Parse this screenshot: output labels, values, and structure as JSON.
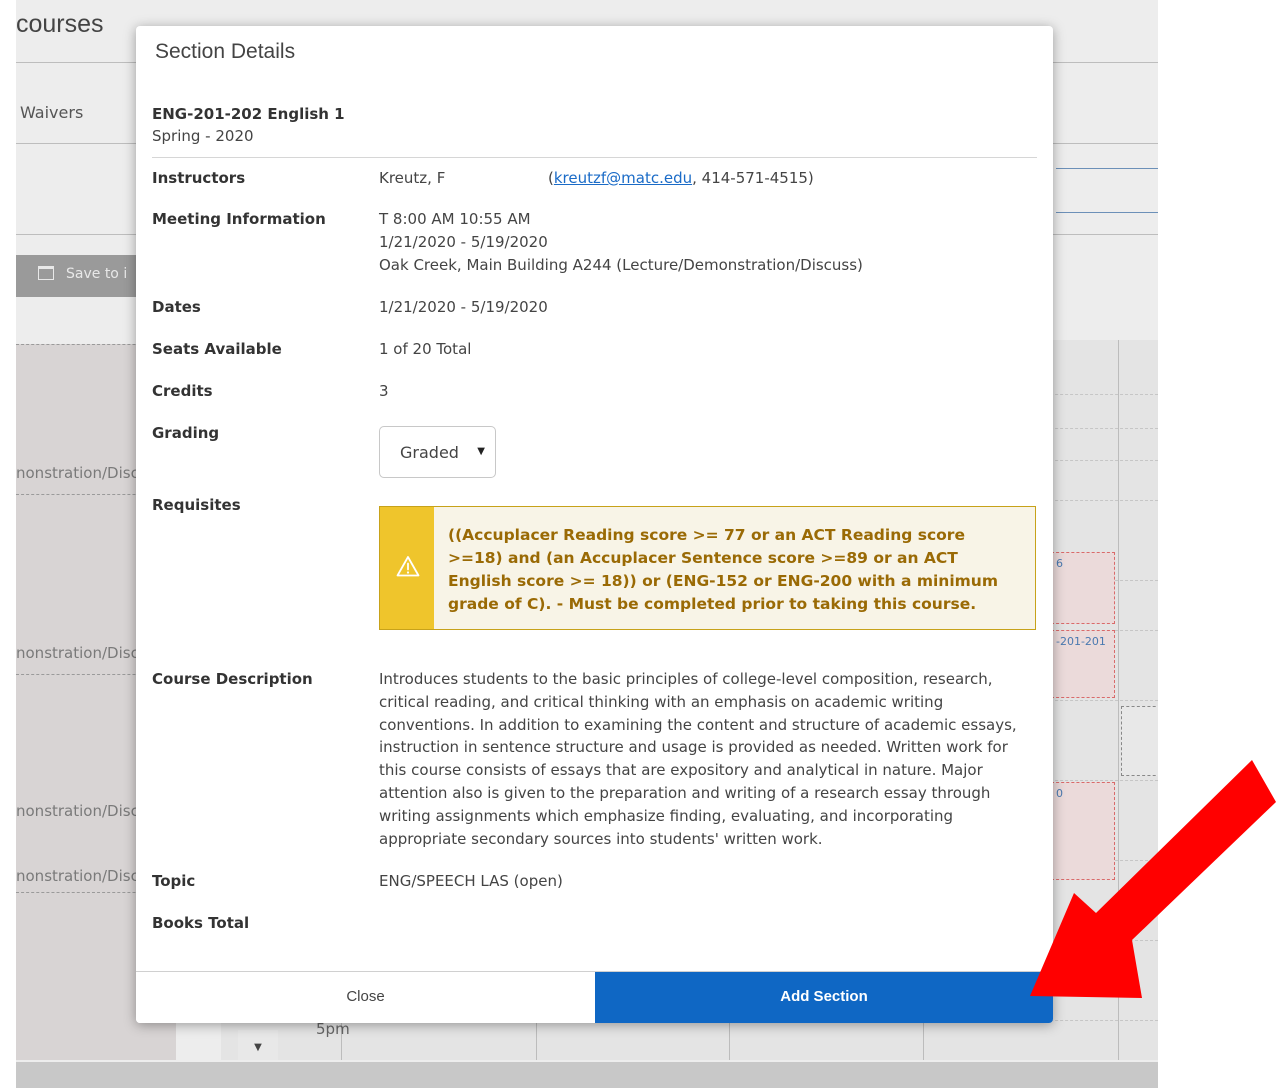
{
  "background": {
    "page_title": "courses",
    "tab_label": "Waivers",
    "save_button_label": "Save to i",
    "list_items": [
      "nonstration/Disc",
      "nonstration/Disc",
      "nonstration/Disc",
      "nonstration/Disc"
    ],
    "cal_cells": [
      "6",
      "-201-201",
      "0"
    ],
    "time_label": "5pm"
  },
  "modal": {
    "title": "Section Details",
    "course_name": "ENG-201-202 English 1",
    "course_term": "Spring - 2020",
    "instructors": {
      "label": "Instructors",
      "name": "Kreutz, F",
      "paren_open": "(",
      "email": "kreutzf@matc.edu",
      "phone_suffix": ", 414-571-4515)"
    },
    "meeting": {
      "label": "Meeting Information",
      "time": "T 8:00 AM 10:55 AM",
      "dates": "1/21/2020 - 5/19/2020",
      "location": "Oak Creek, Main Building A244 (Lecture/Demonstration/Discuss)"
    },
    "dates": {
      "label": "Dates",
      "value": "1/21/2020 - 5/19/2020"
    },
    "seats": {
      "label": "Seats Available",
      "value": "1 of 20 Total"
    },
    "credits": {
      "label": "Credits",
      "value": "3"
    },
    "grading": {
      "label": "Grading",
      "selected": "Graded"
    },
    "requisites": {
      "label": "Requisites",
      "text": "((Accuplacer Reading score >= 77 or an ACT Reading score >=18) and (an Accuplacer Sentence score >=89 or an ACT English score >= 18)) or (ENG-152 or ENG-200 with a minimum grade of C). - Must be completed prior to taking this course."
    },
    "description": {
      "label": "Course Description",
      "text": "Introduces students to the basic principles of college-level composition, research, critical reading, and critical thinking with an emphasis on academic writing conventions. In addition to examining the content and structure of academic essays, instruction in sentence structure and usage is provided as needed. Written work for this course consists of essays that are expository and analytical in nature. Major attention also is given to the preparation and writing of a research essay through writing assignments which emphasize finding, evaluating, and incorporating appropriate secondary sources into students' written work."
    },
    "topic": {
      "label": "Topic",
      "value": "ENG/SPEECH LAS (open)"
    },
    "books": {
      "label": "Books Total"
    },
    "close_label": "Close",
    "add_label": "Add Section"
  },
  "icons": {
    "warning": "warning-icon",
    "calendar": "calendar-icon",
    "caret": "caret-down-icon",
    "annotation": "red-arrow-annotation"
  },
  "colors": {
    "primary": "#0f67c4",
    "warning_bg": "#efc52c",
    "warning_text": "#9a6a05",
    "annotation": "#ff0000"
  }
}
